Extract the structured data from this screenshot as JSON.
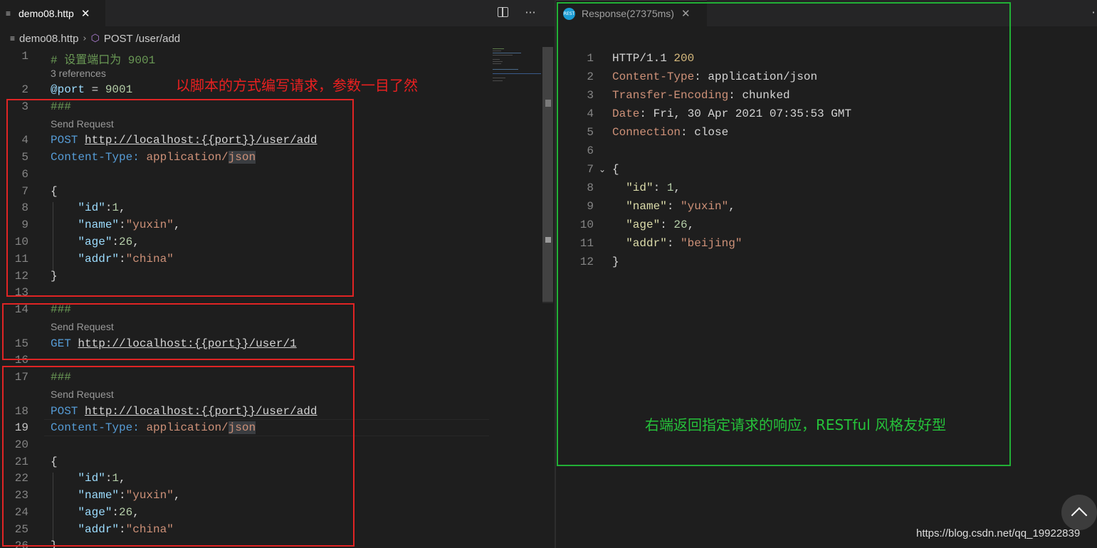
{
  "editor": {
    "tab_label": "demo08.http",
    "breadcrumb": {
      "file": "demo08.http",
      "section": "POST /user/add"
    },
    "icons": {
      "file": "file-lines-icon",
      "close": "close-icon",
      "split": "split-editor-icon",
      "more": "ellipsis-icon",
      "chevron": "chevron-right-icon",
      "symbol": "cube-icon"
    },
    "line_numbers": [
      "1",
      "2",
      "3",
      "4",
      "5",
      "6",
      "7",
      "8",
      "9",
      "10",
      "11",
      "12",
      "13",
      "14",
      "15",
      "16",
      "17",
      "18",
      "19",
      "20",
      "21",
      "22",
      "23",
      "24",
      "25",
      "26"
    ],
    "lens": {
      "references": "3 references",
      "send_request": "Send Request"
    },
    "code": {
      "l1": "# 设置端口为 9001",
      "l2_var": "@port",
      "l2_eq": " = ",
      "l2_val": "9001",
      "hash": "###",
      "post": "POST",
      "get": "GET",
      "url_add": "http://localhost:{{port}}/user/add",
      "url_get": "http://localhost:{{port}}/user/1",
      "ct_key": "Content-Type:",
      "ct_val1": "application/",
      "ct_val2": "json",
      "brace_open": "{",
      "brace_close": "}",
      "k_id": "\"id\"",
      "v_id": "1",
      "k_name": "\"name\"",
      "v_name": "\"yuxin\"",
      "k_age": "\"age\"",
      "v_age": "26",
      "k_addr": "\"addr\"",
      "v_addr": "\"china\"",
      "colon": ":",
      "comma": ","
    },
    "annotation": "以脚本的方式编写请求，参数一目了然"
  },
  "response": {
    "tab_label": "Response(27375ms)",
    "icon": "rest-client-icon",
    "line_numbers": [
      "1",
      "2",
      "3",
      "4",
      "5",
      "6",
      "7",
      "8",
      "9",
      "10",
      "11",
      "12"
    ],
    "status_proto": "HTTP/1.1 ",
    "status_code": "200",
    "headers": [
      {
        "key": "Content-Type",
        "value": "application/json"
      },
      {
        "key": "Transfer-Encoding",
        "value": "chunked"
      },
      {
        "key": "Date",
        "value": "Fri, 30 Apr 2021 07:35:53 GMT"
      },
      {
        "key": "Connection",
        "value": "close"
      }
    ],
    "body": {
      "open": "{",
      "close": "}",
      "k_id": "\"id\"",
      "v_id": "1",
      "k_name": "\"name\"",
      "v_name": "\"yuxin\"",
      "k_age": "\"age\"",
      "v_age": "26",
      "k_addr": "\"addr\"",
      "v_addr": "\"beijing\""
    },
    "annotation": "右端返回指定请求的响应，RESTful 风格友好型"
  },
  "watermark": "https://blog.csdn.net/qq_19922839",
  "scroll_top_icon": "chevron-up-icon",
  "colors": {
    "red_annotation": "#e02424",
    "green_annotation": "#22b036",
    "editor_bg": "#1e1e1e"
  }
}
